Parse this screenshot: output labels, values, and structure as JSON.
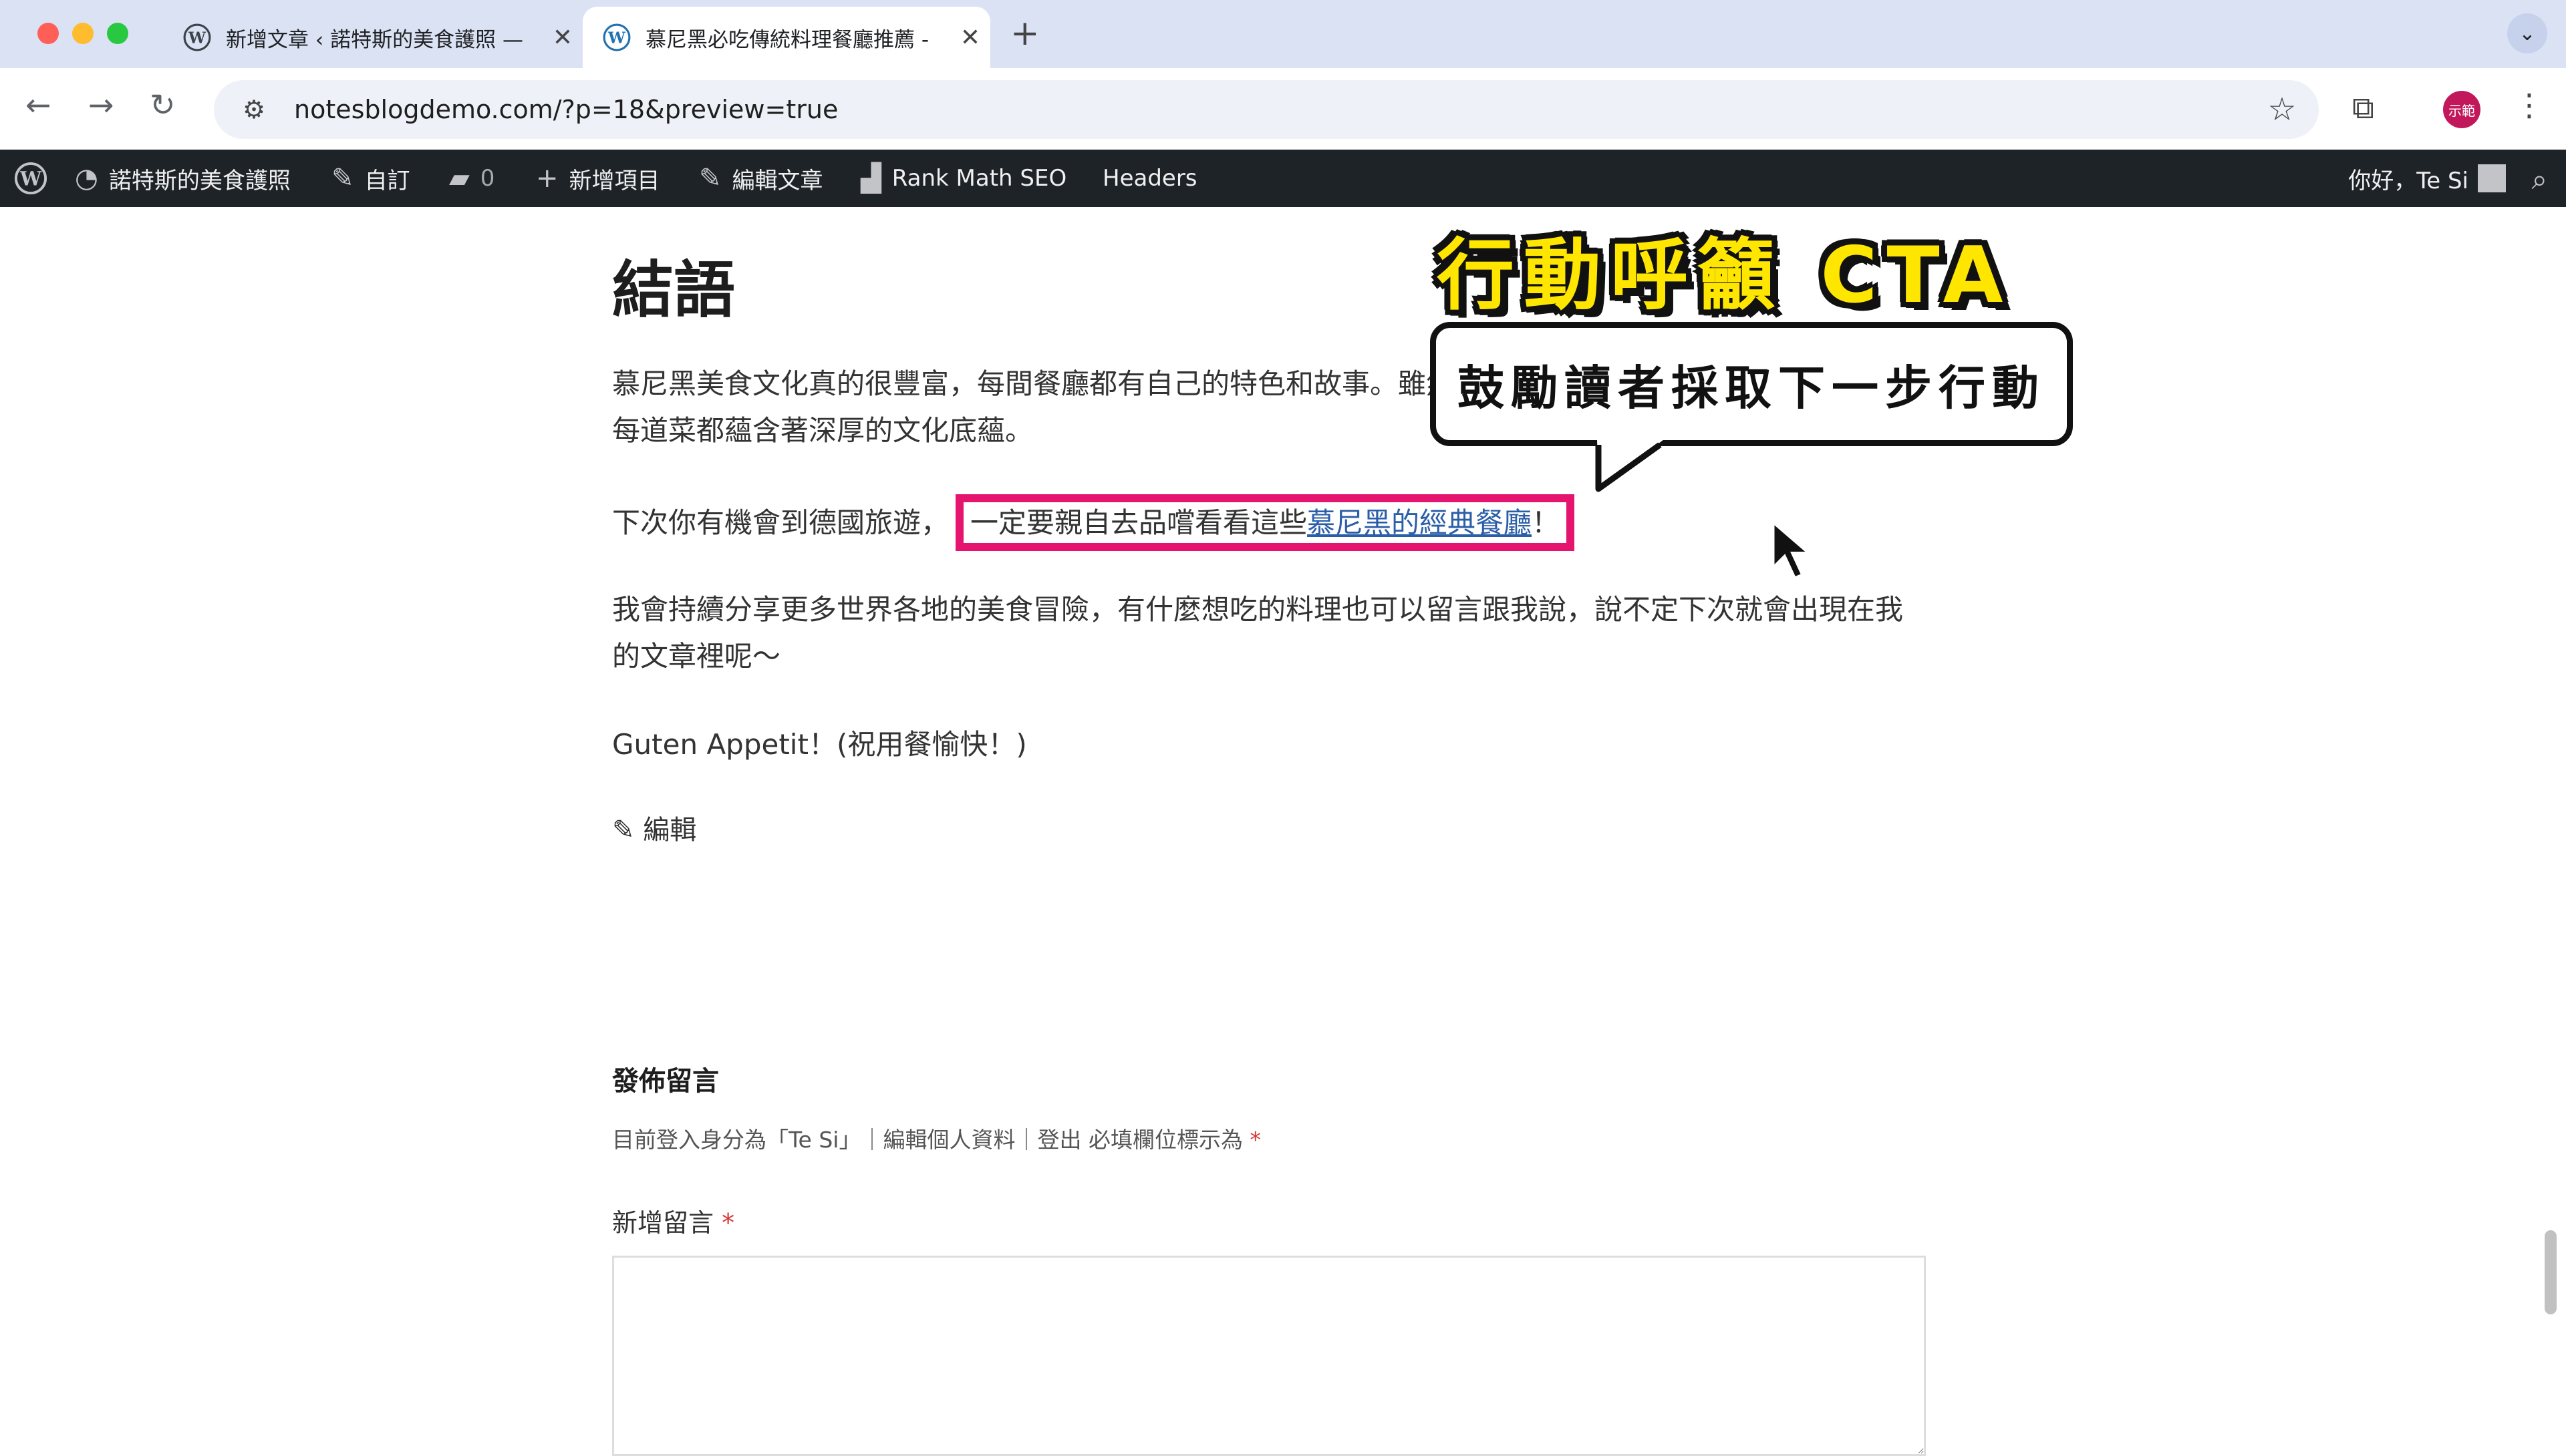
{
  "browser": {
    "tabs": [
      {
        "title": "新增文章 ‹ 諾特斯的美食護照 —",
        "active": false
      },
      {
        "title": "慕尼黑必吃傳統料理餐廳推薦 -",
        "active": true
      }
    ],
    "url": "notesblogdemo.com/?p=18&preview=true",
    "profile_label": "示範"
  },
  "admin_bar": {
    "site_name": "諾特斯的美食護照",
    "customize": "自訂",
    "comments_count": "0",
    "new_item": "新增項目",
    "edit_post": "編輯文章",
    "rank_math": "Rank Math SEO",
    "headers": "Headers",
    "greeting": "你好，Te Si"
  },
  "post": {
    "heading": "結語",
    "p1": "慕尼黑美食文化真的很豐富，每間餐廳都有自己的特色和故事。雖然德國菜看起來可能不太精緻，但其實每道菜都蘊含著深厚的文化底蘊。",
    "p2_before": "下次你有機會到德國旅遊，",
    "p2_highlight": "一定要親自去品嚐看看這些",
    "p2_link": "慕尼黑的經典餐廳",
    "p2_after": "！",
    "p3": "我會持續分享更多世界各地的美食冒險，有什麼想吃的料理也可以留言跟我說，說不定下次就會出現在我的文章裡呢～",
    "p4": "Guten Appetit！(祝用餐愉快！)",
    "edit_label": "編輯"
  },
  "comments": {
    "title": "發佈留言",
    "logged_in_text": "目前登入身分為「Te Si」｜編輯個人資料｜登出 必填欄位標示為",
    "required_mark": "*",
    "new_comment_label": "新增留言"
  },
  "annotation": {
    "title": "行動呼籲 CTA",
    "bubble": "鼓勵讀者採取下一步行動",
    "highlight_color": "#e5146f"
  }
}
